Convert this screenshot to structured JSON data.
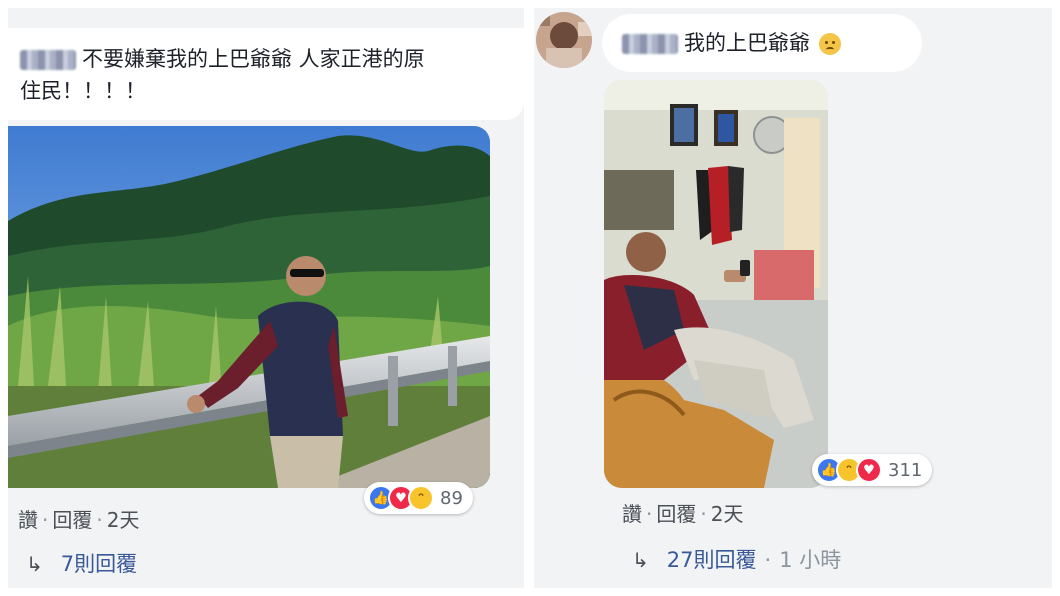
{
  "left": {
    "comment_text_line1": "不要嫌棄我的上巴爺爺 人家正港的原",
    "comment_text_line2": "住民！！！！",
    "like": "讚",
    "reply": "回覆",
    "time": "2天",
    "reaction_count": "89",
    "replies": "7則回覆"
  },
  "right": {
    "comment_text": "我的上巴爺爺",
    "like": "讚",
    "reply": "回覆",
    "time": "2天",
    "reaction_count": "311",
    "replies": "27則回覆",
    "reply_time": "1 小時"
  },
  "icons": [
    "like-icon",
    "love-icon",
    "haha-icon",
    "sad-emoji-icon",
    "reply-arrow-icon"
  ],
  "colors": {
    "panel_bg": "#f2f3f5",
    "bubble_bg": "#ffffff",
    "link": "#385898",
    "like_blue": "#3b78ef",
    "love_red": "#f0284a"
  }
}
